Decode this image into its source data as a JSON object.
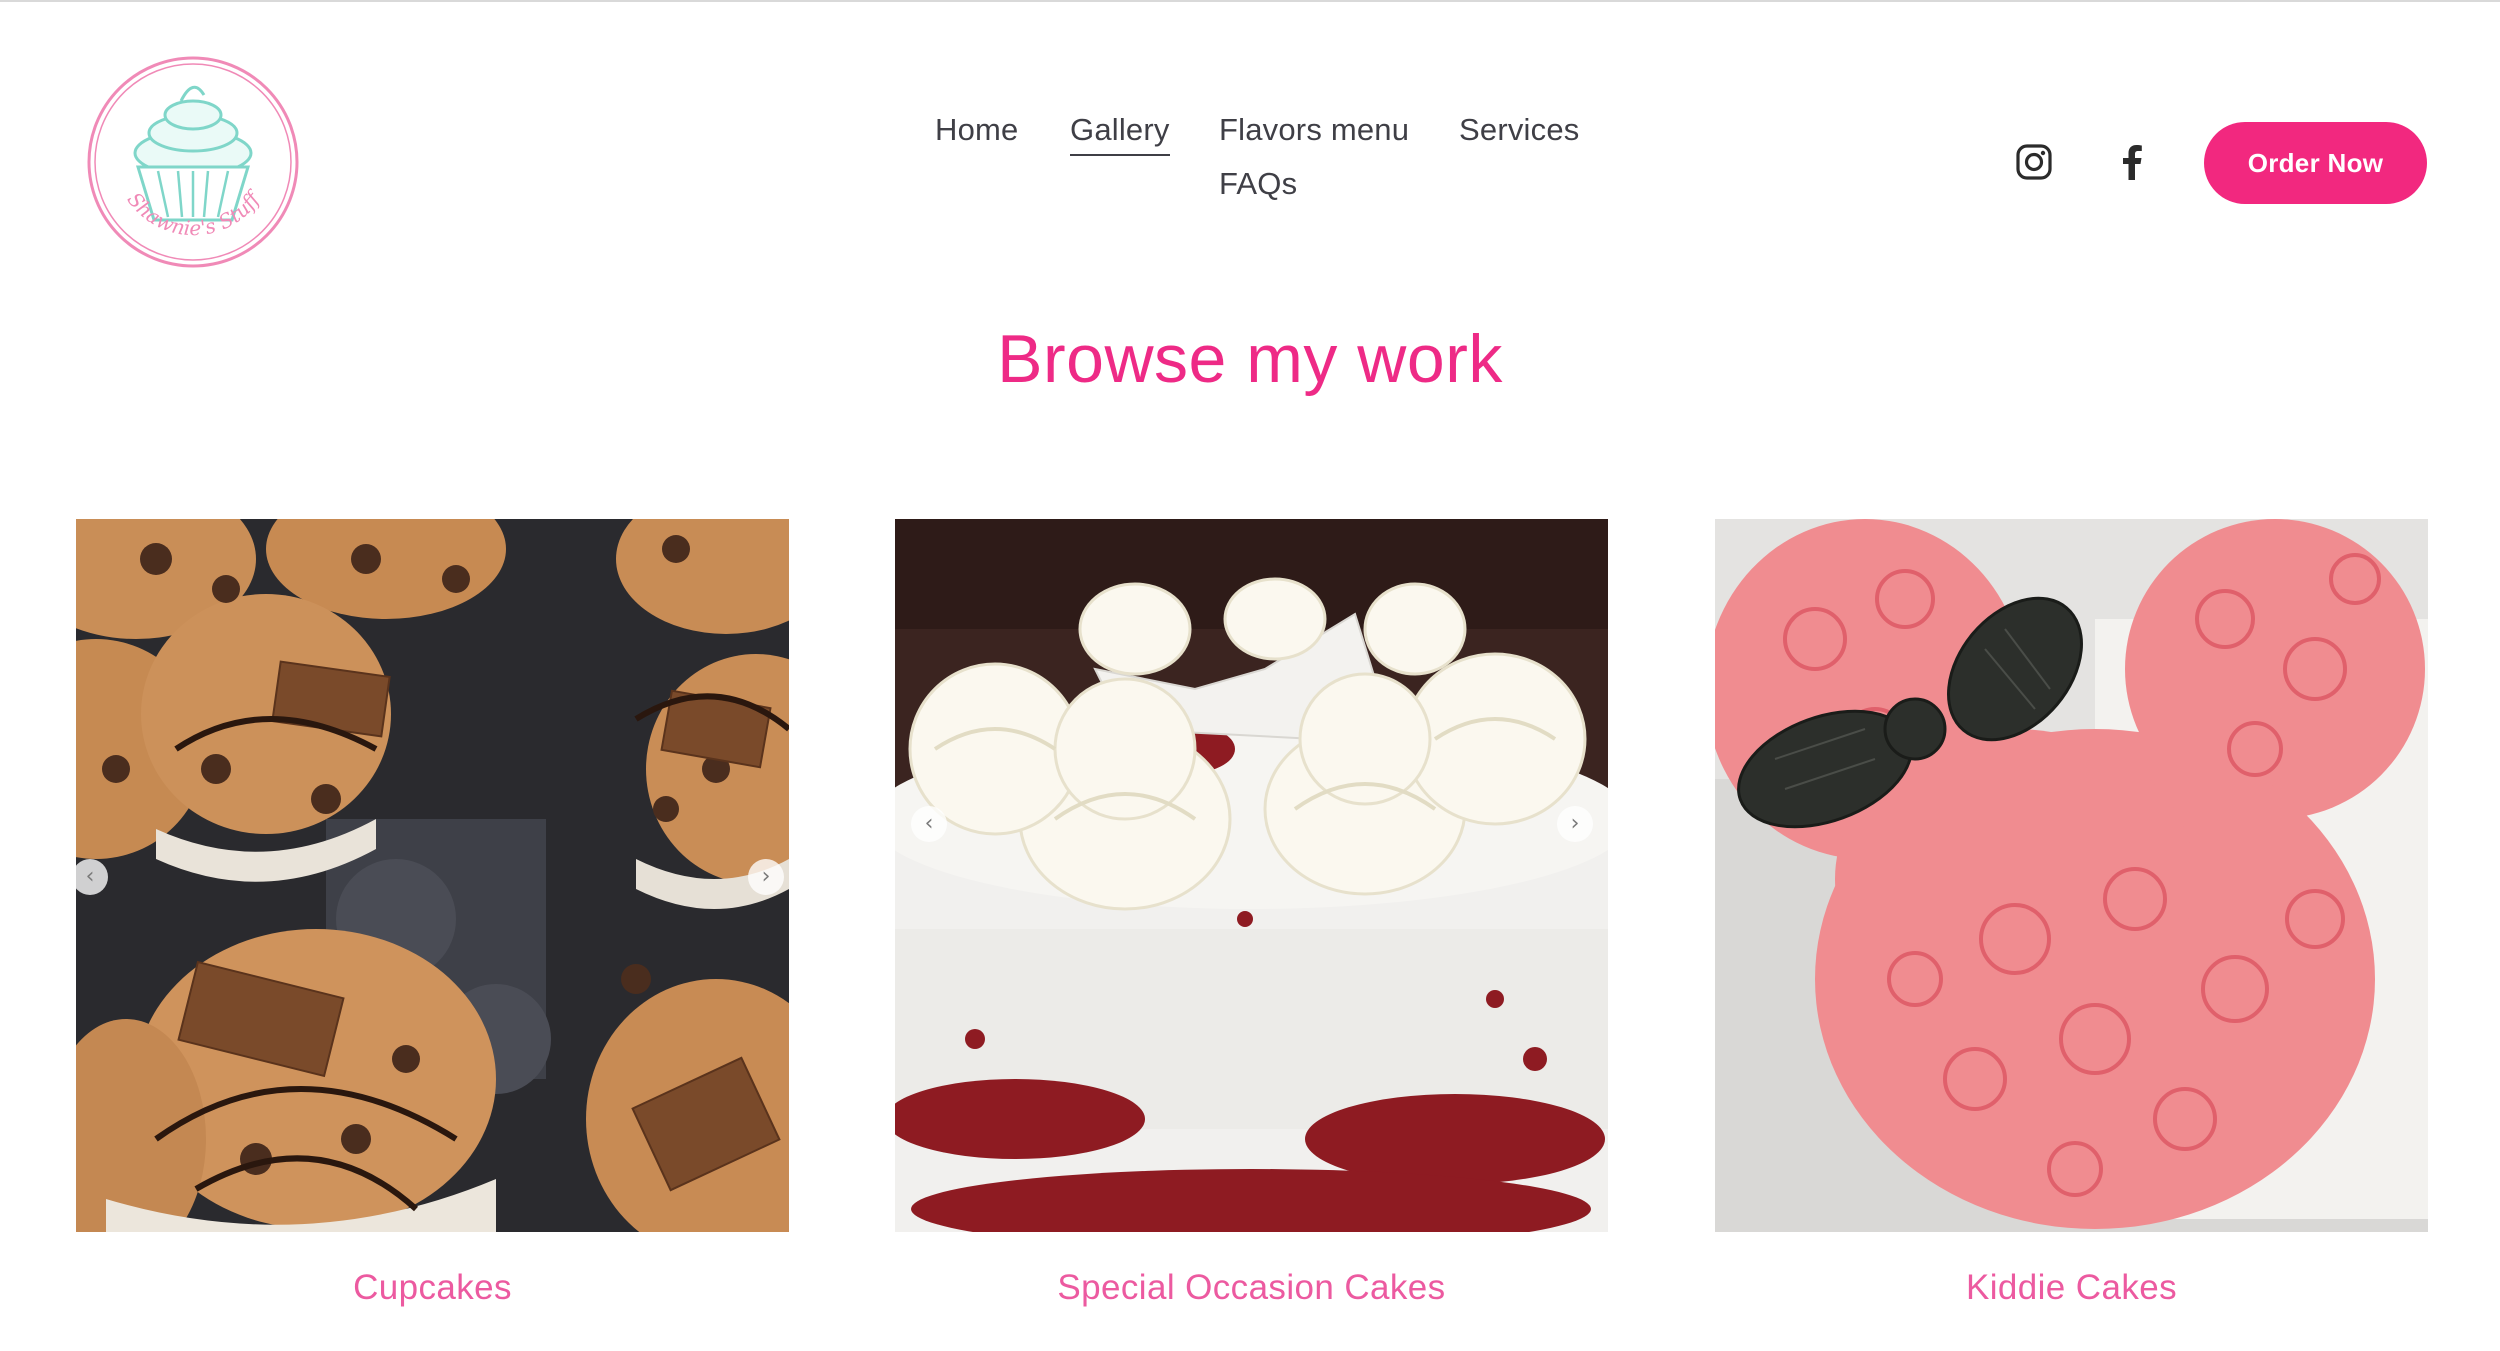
{
  "brand": {
    "logo_text": "Shawnie's Stuff",
    "colors": {
      "accent": "#f2287f",
      "title": "#ee2a86",
      "label": "#ec5aa0",
      "nav_text": "#3f3f46",
      "logo_mint": "#7fd6c9",
      "logo_pink": "#f08ab7"
    }
  },
  "nav": {
    "items": [
      {
        "label": "Home"
      },
      {
        "label": "Gallery"
      },
      {
        "label": "Flavors menu"
      },
      {
        "label": "Services"
      },
      {
        "label": "FAQs"
      }
    ],
    "active": "Gallery"
  },
  "social": {
    "icons": [
      "instagram-icon",
      "facebook-icon"
    ]
  },
  "header": {
    "order_button": "Order Now"
  },
  "main": {
    "title": "Browse my work",
    "gallery": [
      {
        "label": "Cupcakes",
        "image": "chocolate cupcakes with Hershey's bars"
      },
      {
        "label": "Special Occasion Cakes",
        "image": "white frosted red velvet cake"
      },
      {
        "label": "Kiddie Cakes",
        "image": "pink Minnie Mouse cupcake cake"
      }
    ]
  }
}
